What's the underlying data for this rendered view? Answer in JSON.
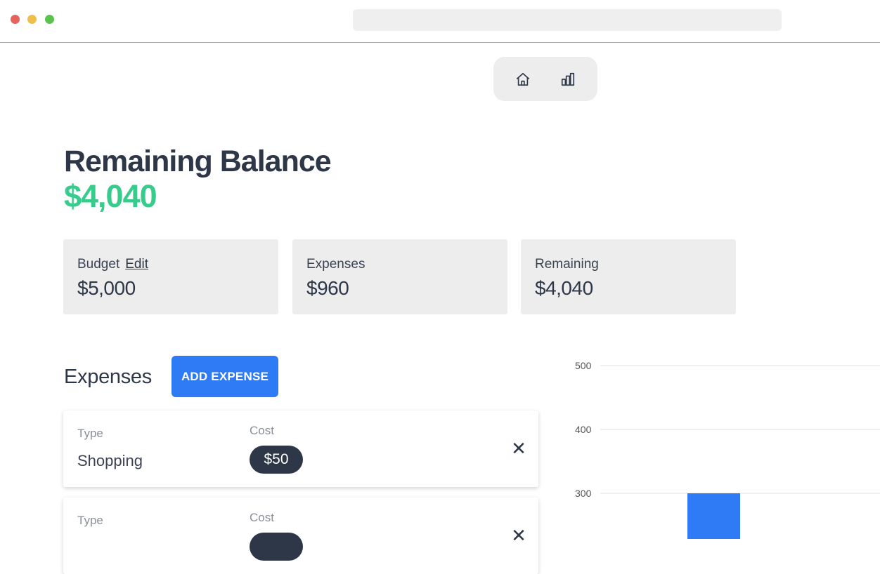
{
  "nav": {
    "items": [
      {
        "icon": "home-icon"
      },
      {
        "icon": "bar-chart-icon"
      }
    ]
  },
  "balance": {
    "title": "Remaining Balance",
    "value": "$4,040",
    "value_color": "#38cc8c"
  },
  "cards": {
    "budget": {
      "label": "Budget",
      "edit_label": "Edit",
      "value": "$5,000"
    },
    "expenses": {
      "label": "Expenses",
      "value": "$960"
    },
    "remaining": {
      "label": "Remaining",
      "value": "$4,040"
    }
  },
  "expenses_section": {
    "heading": "Expenses",
    "add_button_label": "ADD EXPENSE",
    "add_button_color": "#2f7bf5",
    "items": [
      {
        "type_label": "Type",
        "type": "Shopping",
        "cost_label": "Cost",
        "cost": "$50",
        "remove_label": "✕"
      },
      {
        "type_label": "Type",
        "type": "",
        "cost_label": "Cost",
        "cost": "",
        "remove_label": "✕"
      }
    ]
  },
  "chart_data": {
    "type": "bar",
    "y_ticks": [
      "500",
      "400",
      "300"
    ],
    "ylim": [
      0,
      500
    ],
    "grid": true,
    "series": [
      {
        "values": [
          300
        ],
        "color": "#2f7bf5"
      }
    ]
  }
}
